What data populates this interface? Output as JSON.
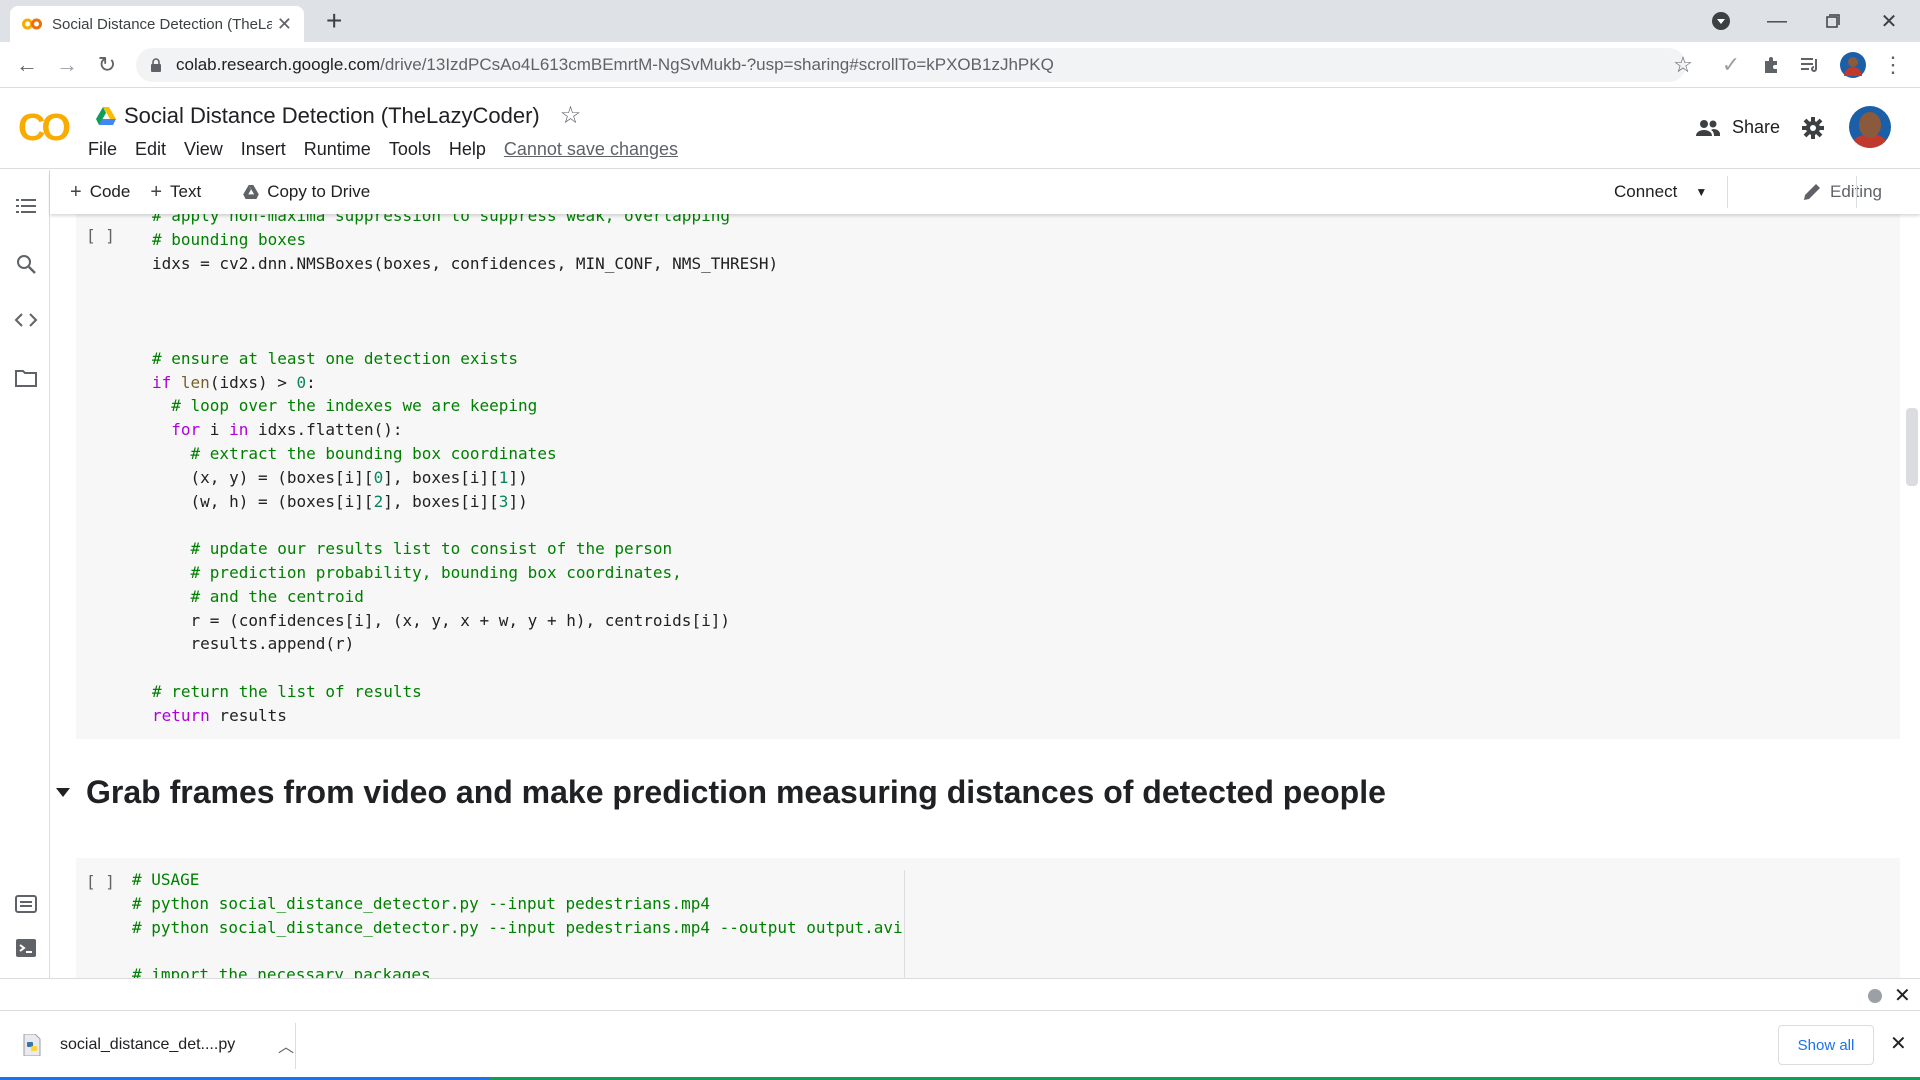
{
  "browser": {
    "tab_title": "Social Distance Detection (TheLa",
    "url_host": "colab.research.google.com",
    "url_path": "/drive/13IzdPCsAo4L613cmBEmrtM-NgSvMukb-?usp=sharing#scrollTo=kPXOB1zJhPKQ"
  },
  "colab": {
    "notebook_title": "Social Distance Detection (TheLazyCoder)",
    "menu": [
      "File",
      "Edit",
      "View",
      "Insert",
      "Runtime",
      "Tools",
      "Help"
    ],
    "save_warning": "Cannot save changes",
    "share_label": "Share",
    "toolbar": {
      "code": "Code",
      "text": "Text",
      "copy_to_drive": "Copy to Drive",
      "connect": "Connect",
      "editing": "Editing"
    }
  },
  "cells": {
    "cell_a_run": "[ ]",
    "section_heading": "Grab frames from video and make prediction measuring distances of detected people",
    "cell_b_run": "[ ]"
  },
  "download": {
    "file_name": "social_distance_det....py",
    "show_all": "Show all"
  },
  "colors": {
    "accent": "#1a73e8",
    "comment": "#008000",
    "keyword": "#af00db",
    "number": "#098658",
    "colab_logo": "#f9ab00"
  }
}
